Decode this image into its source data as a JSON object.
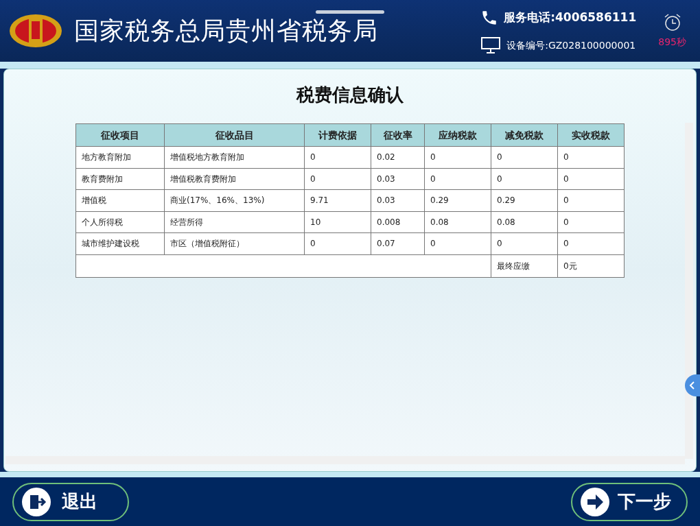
{
  "header": {
    "title": "国家税务总局贵州省税务局",
    "phone_label": "服务电话:",
    "phone": "4006586111",
    "device_label": "设备编号:",
    "device": "GZ028100000001",
    "countdown": "895秒"
  },
  "page_title": "税费信息确认",
  "table": {
    "columns": [
      "征收项目",
      "征收品目",
      "计费依据",
      "征收率",
      "应纳税款",
      "减免税款",
      "实收税款"
    ],
    "rows": [
      [
        "地方教育附加",
        "增值税地方教育附加",
        "0",
        "0.02",
        "0",
        "0",
        "0"
      ],
      [
        "教育费附加",
        "增值税教育费附加",
        "0",
        "0.03",
        "0",
        "0",
        "0"
      ],
      [
        "增值税",
        "商业(17%、16%、13%)",
        "9.71",
        "0.03",
        "0.29",
        "0.29",
        "0"
      ],
      [
        "个人所得税",
        "经营所得",
        "10",
        "0.008",
        "0.08",
        "0.08",
        "0"
      ],
      [
        "城市维护建设税",
        "市区（增值税附征）",
        "0",
        "0.07",
        "0",
        "0",
        "0"
      ]
    ],
    "total_label": "最终应缴",
    "total": "0元"
  },
  "footer": {
    "exit_button": "退出",
    "next_button": "下一步"
  }
}
